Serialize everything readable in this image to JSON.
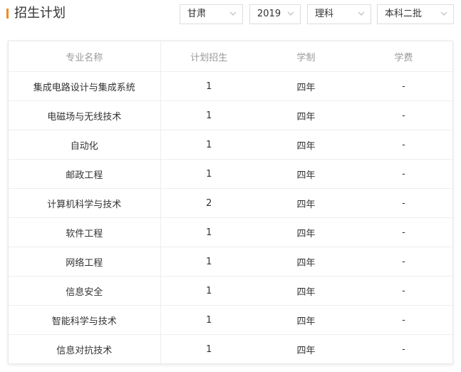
{
  "header": {
    "title": "招生计划"
  },
  "filters": {
    "province": "甘肃",
    "year": "2019",
    "subject": "理科",
    "batch": "本科二批"
  },
  "table": {
    "columns": [
      "专业名称",
      "计划招生",
      "学制",
      "学费"
    ],
    "rows": [
      {
        "major": "集成电路设计与集成系统",
        "plan": "1",
        "duration": "四年",
        "fee": "-"
      },
      {
        "major": "电磁场与无线技术",
        "plan": "1",
        "duration": "四年",
        "fee": "-"
      },
      {
        "major": "自动化",
        "plan": "1",
        "duration": "四年",
        "fee": "-"
      },
      {
        "major": "邮政工程",
        "plan": "1",
        "duration": "四年",
        "fee": "-"
      },
      {
        "major": "计算机科学与技术",
        "plan": "2",
        "duration": "四年",
        "fee": "-"
      },
      {
        "major": "软件工程",
        "plan": "1",
        "duration": "四年",
        "fee": "-"
      },
      {
        "major": "网络工程",
        "plan": "1",
        "duration": "四年",
        "fee": "-"
      },
      {
        "major": "信息安全",
        "plan": "1",
        "duration": "四年",
        "fee": "-"
      },
      {
        "major": "智能科学与技术",
        "plan": "1",
        "duration": "四年",
        "fee": "-"
      },
      {
        "major": "信息对抗技术",
        "plan": "1",
        "duration": "四年",
        "fee": "-"
      }
    ]
  },
  "colors": {
    "accent": "#f08a24",
    "header_text": "#999999",
    "body_text": "#333333",
    "border": "#eeeeee"
  },
  "icons": {
    "dropdown": "chevron-down-icon",
    "title_marker": "accent-bar"
  }
}
